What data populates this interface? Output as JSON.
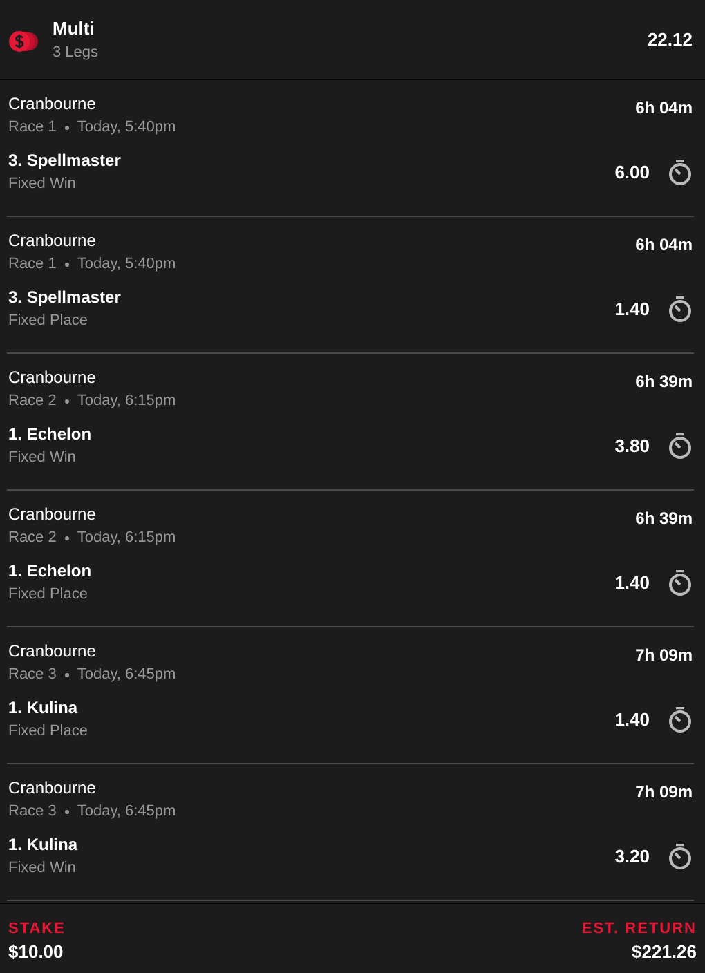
{
  "bet": {
    "title": "Multi",
    "subtitle": "3 Legs",
    "odds": "22.12"
  },
  "legs": [
    {
      "venue": "Cranbourne",
      "race": "Race 1",
      "time": "Today, 5:40pm",
      "countdown": "6h 04m",
      "runner": "3. Spellmaster",
      "bet_type": "Fixed Win",
      "price": "6.00"
    },
    {
      "venue": "Cranbourne",
      "race": "Race 1",
      "time": "Today, 5:40pm",
      "countdown": "6h 04m",
      "runner": "3. Spellmaster",
      "bet_type": "Fixed Place",
      "price": "1.40"
    },
    {
      "venue": "Cranbourne",
      "race": "Race 2",
      "time": "Today, 6:15pm",
      "countdown": "6h 39m",
      "runner": "1. Echelon",
      "bet_type": "Fixed Win",
      "price": "3.80"
    },
    {
      "venue": "Cranbourne",
      "race": "Race 2",
      "time": "Today, 6:15pm",
      "countdown": "6h 39m",
      "runner": "1. Echelon",
      "bet_type": "Fixed Place",
      "price": "1.40"
    },
    {
      "venue": "Cranbourne",
      "race": "Race 3",
      "time": "Today, 6:45pm",
      "countdown": "7h 09m",
      "runner": "1. Kulina",
      "bet_type": "Fixed Place",
      "price": "1.40"
    },
    {
      "venue": "Cranbourne",
      "race": "Race 3",
      "time": "Today, 6:45pm",
      "countdown": "7h 09m",
      "runner": "1. Kulina",
      "bet_type": "Fixed Win",
      "price": "3.20"
    }
  ],
  "footer": {
    "stake_label": "STAKE",
    "stake": "$10.00",
    "return_label": "EST. RETURN",
    "return": "$221.26"
  }
}
